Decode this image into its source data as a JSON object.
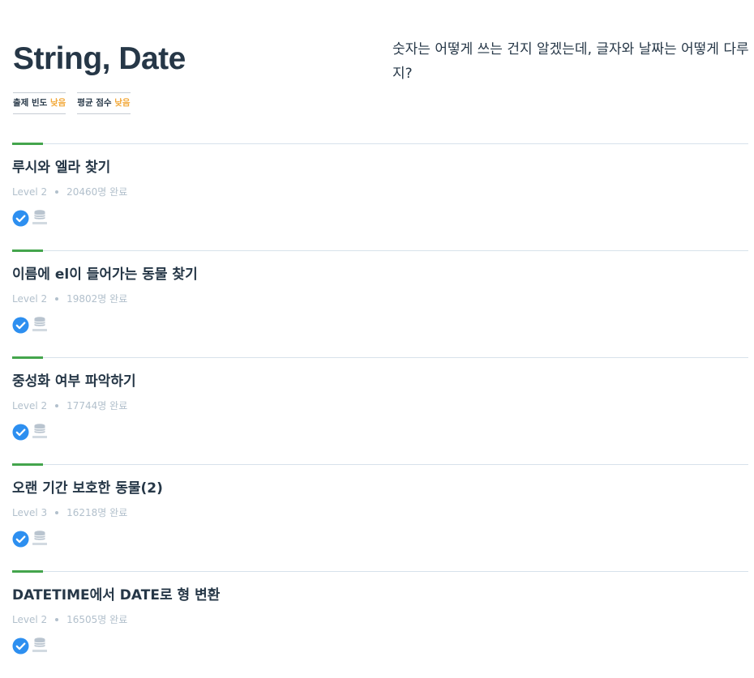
{
  "header": {
    "title": "String, Date",
    "description": "숫자는 어떻게 쓰는 건지 알겠는데, 글자와 날짜는 어떻게 다루지?",
    "badges": [
      {
        "label": "출제 빈도",
        "level": "낮음"
      },
      {
        "label": "평균 점수",
        "level": "낮음"
      }
    ]
  },
  "colors": {
    "accent_green": "#44a54c",
    "badge_level_orange": "#f2a93b",
    "check_blue": "#2d8ff0",
    "meta_gray": "#b2c0cc",
    "title_dark": "#263747"
  },
  "problems": [
    {
      "title": "루시와 엘라 찾기",
      "level": "Level 2",
      "completed": "20460명 완료",
      "icons": [
        "check-icon",
        "oracle-db-icon"
      ]
    },
    {
      "title": "이름에 el이 들어가는 동물 찾기",
      "level": "Level 2",
      "completed": "19802명 완료",
      "icons": [
        "check-icon",
        "oracle-db-icon"
      ]
    },
    {
      "title": "중성화 여부 파악하기",
      "level": "Level 2",
      "completed": "17744명 완료",
      "icons": [
        "check-icon",
        "oracle-db-icon"
      ]
    },
    {
      "title": "오랜 기간 보호한 동물(2)",
      "level": "Level 3",
      "completed": "16218명 완료",
      "icons": [
        "check-icon",
        "oracle-db-icon"
      ]
    },
    {
      "title": "DATETIME에서 DATE로 형 변환",
      "level": "Level 2",
      "completed": "16505명 완료",
      "icons": [
        "check-icon",
        "oracle-db-icon"
      ]
    }
  ]
}
